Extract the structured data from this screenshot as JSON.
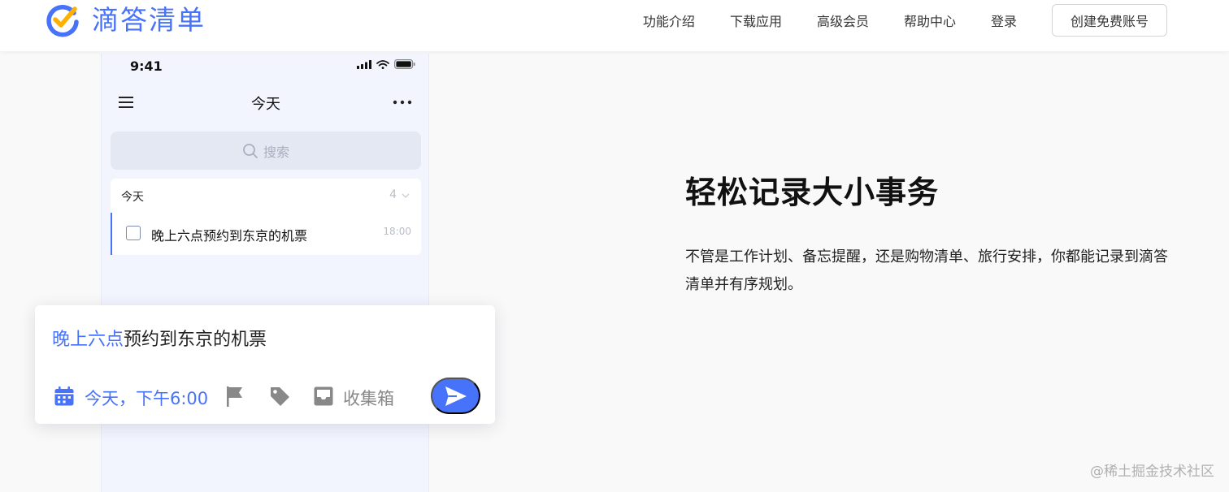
{
  "brand": {
    "name": "滴答清单",
    "accent_color": "#4772fa",
    "check_color": "#ffb000"
  },
  "nav": {
    "links": [
      "功能介绍",
      "下载应用",
      "高级会员",
      "帮助中心",
      "登录"
    ],
    "cta_label": "创建免费账号"
  },
  "phone": {
    "status_time": "9:41",
    "title": "今天",
    "search_placeholder": "搜索",
    "section": {
      "label": "今天",
      "count": "4"
    },
    "task": {
      "text": "晚上六点预约到东京的机票",
      "time": "18:00",
      "completed": false
    }
  },
  "quick_add": {
    "highlight": "晚上六点",
    "text": "预约到东京的机票",
    "date_label": "今天，下午6:00",
    "list_label": "收集箱"
  },
  "hero": {
    "title": "轻松记录大小事务",
    "description": "不管是工作计划、备忘提醒，还是购物清单、旅行安排，你都能记录到滴答清单并有序规划。"
  },
  "watermark": "@稀土掘金技术社区"
}
